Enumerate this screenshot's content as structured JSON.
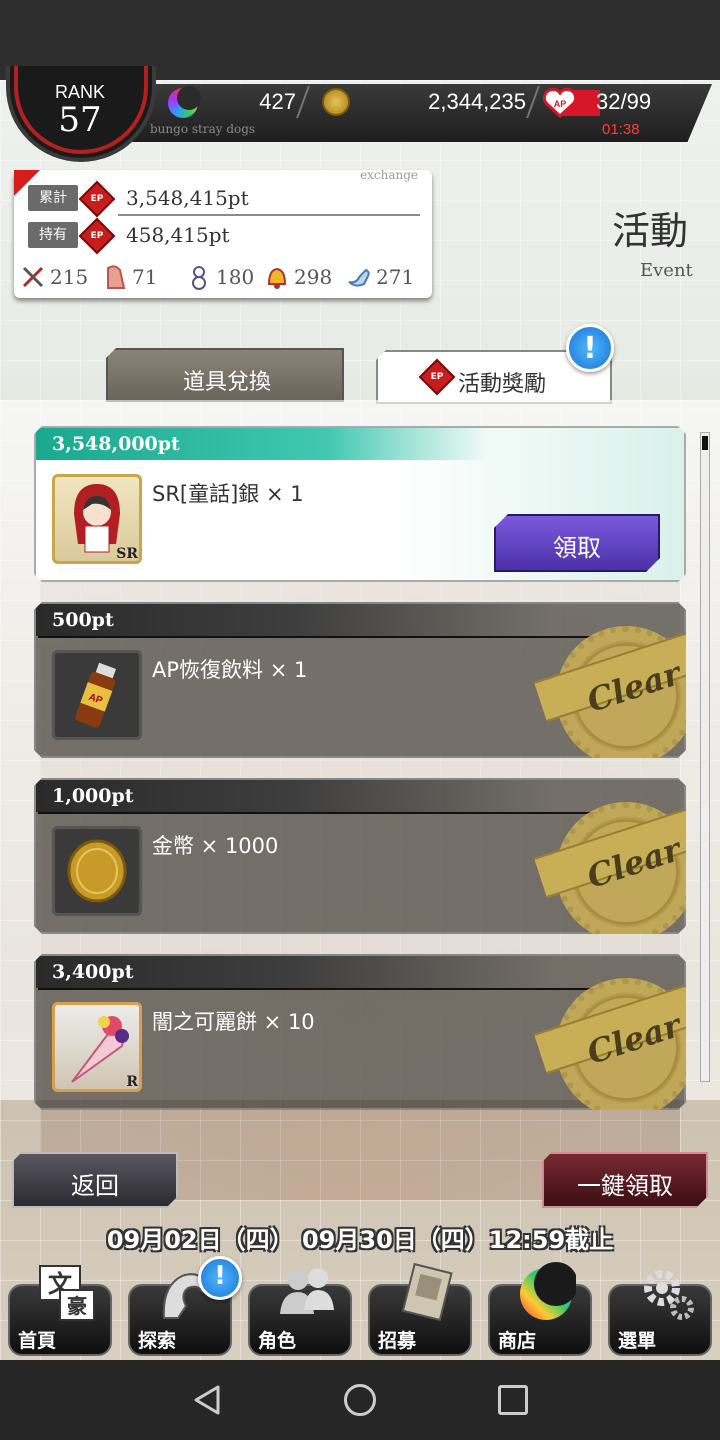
{
  "header": {
    "rank_label": "RANK",
    "rank_value": "57",
    "subtitle": "bungo stray dogs",
    "moon_count": "427",
    "coins": "2,344,235",
    "ap": "32/99",
    "ap_icon_text": "AP",
    "ap_timer": "01:38"
  },
  "ep_panel": {
    "exchange_label": "exchange",
    "total_label": "累計",
    "total_value": "3,548,415pt",
    "owned_label": "持有",
    "owned_value": "458,415pt",
    "ep_icon_text": "EP",
    "stats": [
      "215",
      "71",
      "180",
      "298",
      "271"
    ]
  },
  "title": {
    "main": "活動",
    "sub": "Event"
  },
  "tabs": [
    {
      "label": "道具兌換"
    },
    {
      "label": "活動獎勵"
    }
  ],
  "rewards": [
    {
      "points": "3,548,000pt",
      "name": "SR[童話]銀 × 1",
      "rarity": "SR",
      "claim_label": "領取"
    },
    {
      "points": "500pt",
      "name": "AP恢復飲料 × 1",
      "stamp": "Clear"
    },
    {
      "points": "1,000pt",
      "name": "金幣 × 1000",
      "stamp": "Clear"
    },
    {
      "points": "3,400pt",
      "name": "闇之可麗餅 × 10",
      "rarity": "R",
      "stamp": "Clear"
    }
  ],
  "buttons": {
    "back": "返回",
    "claim_all": "一鍵領取"
  },
  "period": "09月02日（四）  09月30日（四）12:59截止",
  "menu": [
    {
      "label": "首頁",
      "icon": "bungo-logo-icon"
    },
    {
      "label": "探索",
      "icon": "explore-icon"
    },
    {
      "label": "角色",
      "icon": "characters-icon"
    },
    {
      "label": "招募",
      "icon": "recruit-icon"
    },
    {
      "label": "商店",
      "icon": "shop-icon"
    },
    {
      "label": "選單",
      "icon": "gear-icon"
    }
  ],
  "colors": {
    "claim_button": "#5a3ec0",
    "accent_teal": "#1aa88f",
    "badge_blue": "#1e88e5",
    "ap_red": "#d8162a"
  }
}
